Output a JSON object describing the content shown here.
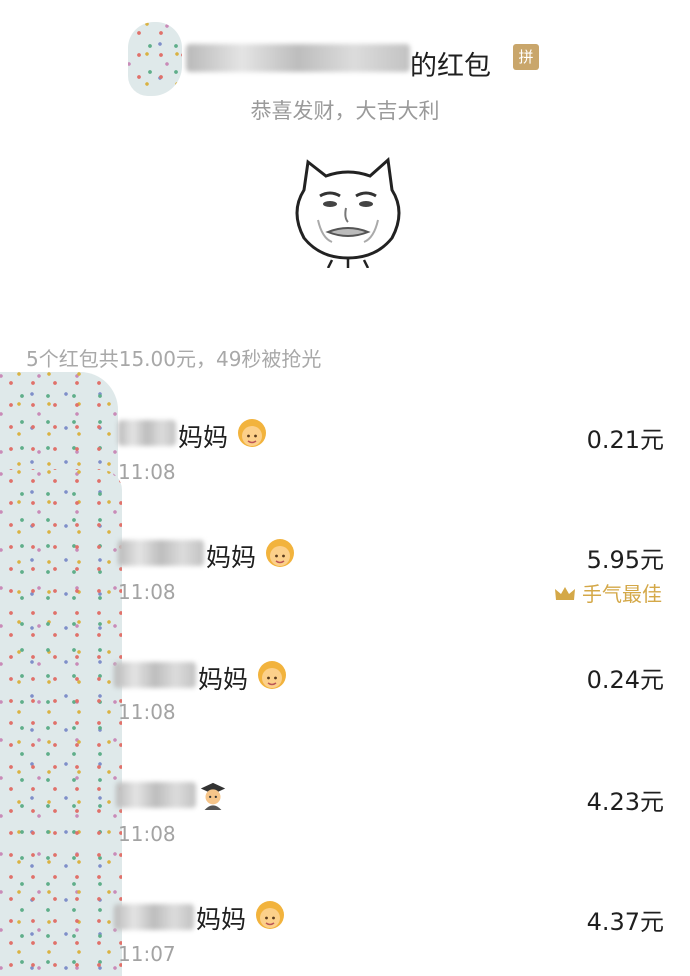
{
  "header": {
    "title_suffix": "的红包",
    "badge": "拼",
    "blessing": "恭喜发财，大吉大利"
  },
  "summary": "5个红包共15.00元，49秒被抢光",
  "best_label": "手气最佳",
  "records": [
    {
      "name_suffix": "妈妈",
      "emoji": "woman-blond-icon",
      "time": "11:08",
      "amount": "0.21元"
    },
    {
      "name_suffix": "妈妈",
      "emoji": "woman-blond-icon",
      "time": "11:08",
      "amount": "5.95元",
      "best": true
    },
    {
      "name_suffix": "妈妈",
      "emoji": "woman-blond-icon",
      "time": "11:08",
      "amount": "0.24元"
    },
    {
      "name_suffix": "",
      "emoji": "graduate-icon",
      "time": "11:08",
      "amount": "4.23元"
    },
    {
      "name_suffix": "妈妈",
      "emoji": "woman-blond-icon",
      "time": "11:07",
      "amount": "4.37元"
    }
  ],
  "colors": {
    "best_gold": "#d4a848",
    "badge_bg": "#c9a66b",
    "muted": "#a3a3a3"
  }
}
